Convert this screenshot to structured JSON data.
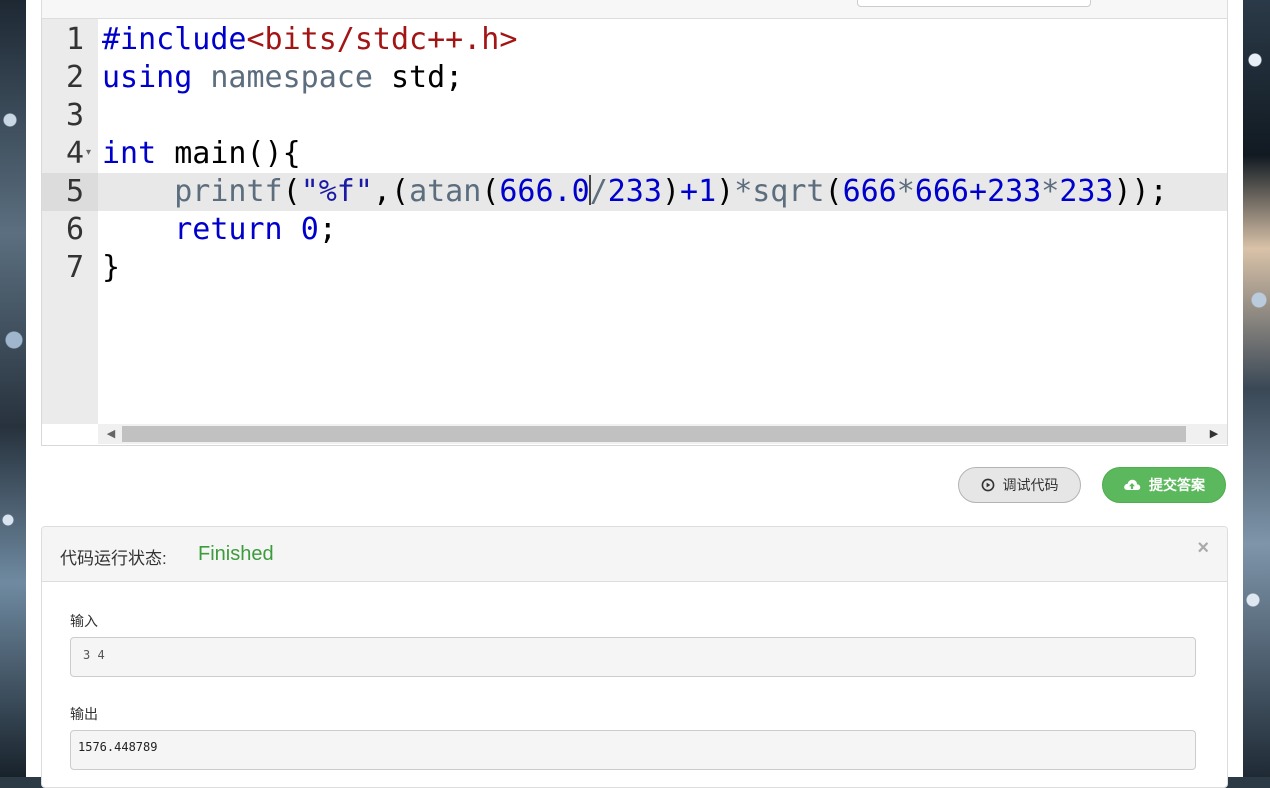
{
  "editor": {
    "line_numbers": [
      "1",
      "2",
      "3",
      "4",
      "5",
      "6",
      "7"
    ],
    "lines": {
      "l1_include": "#include",
      "l1_header": "<bits/stdc++.h>",
      "l2_using": "using",
      "l2_namespace": "namespace",
      "l2_std": "std;",
      "l4_int": "int",
      "l4_rest": "main(){",
      "l5_indent": "    ",
      "l5_printf": "printf",
      "l5_p1": "(",
      "l5_str": "\"%f\"",
      "l5_p2": ",(",
      "l5_atan": "atan",
      "l5_p3": "(",
      "l5_n1": "666.0",
      "l5_div": "/",
      "l5_n2": "233",
      "l5_p4": ")",
      "l5_plus": "+",
      "l5_n3": "1",
      "l5_p5": ")",
      "l5_mul": "*",
      "l5_sqrt": "sqrt",
      "l5_p6": "(",
      "l5_n4": "666",
      "l5_mul2": "*",
      "l5_n5": "666",
      "l5_plus2": "+",
      "l5_n6": "233",
      "l5_mul3": "*",
      "l5_n7": "233",
      "l5_end": "));",
      "l6_indent": "    ",
      "l6_return": "return",
      "l6_zero": "0",
      "l6_semi": ";",
      "l7": "}"
    },
    "active_line": 5
  },
  "buttons": {
    "debug_label": "调试代码",
    "submit_label": "提交答案"
  },
  "result": {
    "status_label": "代码运行状态:",
    "status_value": "Finished",
    "close": "×",
    "input_label": "输入",
    "input_value": "3 4",
    "output_label": "输出",
    "output_value": "1576.448789"
  },
  "colors": {
    "status_finished": "#3c9b3c",
    "submit_green": "#5cb85c"
  },
  "icons": [
    "play-circle-icon",
    "cloud-upload-icon",
    "close-icon",
    "scroll-left-icon",
    "scroll-right-icon",
    "fold-icon"
  ]
}
